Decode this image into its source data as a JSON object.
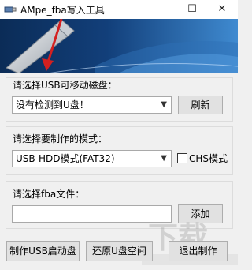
{
  "window": {
    "title": "AMpe_fba写入工具",
    "minimize": "—",
    "maximize": "☐",
    "close": "✕"
  },
  "usb_group": {
    "label": "请选择USB可移动磁盘：",
    "selected": "没有检测到U盘！",
    "refresh_button": "刷新"
  },
  "mode_group": {
    "label": "请选择要制作的模式：",
    "selected": "USB-HDD模式(FAT32)",
    "chs_label": "CHS模式",
    "chs_checked": false
  },
  "fba_group": {
    "label": "请选择fba文件：",
    "file_value": "",
    "add_button": "添加"
  },
  "actions": {
    "make_button": "制作USB启动盘",
    "restore_button": "还原U盘空间",
    "exit_button": "退出制作"
  },
  "colors": {
    "banner_dark": "#0b2c57",
    "banner_light": "#3f8ad0",
    "arrow": "#d42020"
  }
}
